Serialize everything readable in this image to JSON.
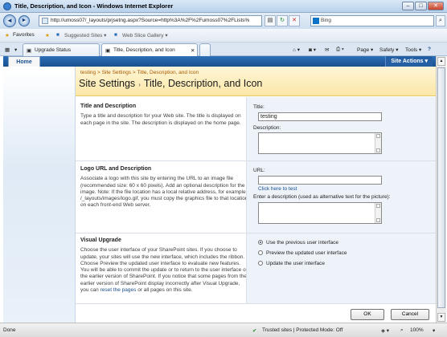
{
  "window": {
    "title": "Title, Description, and Icon - Windows Internet Explorer",
    "min": "–",
    "max": "□",
    "close": "✕"
  },
  "address": {
    "url": "http://umoss07/_layouts/prjsetng.aspx?Source=http%3A%2F%2Fumoss07%2FLists%",
    "search_placeholder": "Bing"
  },
  "favorites": {
    "label": "Favorites",
    "suggested": "Suggested Sites ▾",
    "slice": "Web Slice Gallery ▾"
  },
  "tabs": {
    "tab1": "Upgrade Status",
    "tab2": "Title, Description, and Icon"
  },
  "commandbar": {
    "page": "Page ▾",
    "safety": "Safety ▾",
    "tools": "Tools ▾",
    "help": "?"
  },
  "ribbon": {
    "home": "Home",
    "site_actions": "Site Actions ▾"
  },
  "breadcrumb": {
    "site": "testing",
    "sep1": ">",
    "settings": "Site Settings",
    "sep2": ">",
    "current": "Title, Description, and Icon"
  },
  "page_title": {
    "main": "Site Settings",
    "sep": "›",
    "sub": "Title, Description, and Icon"
  },
  "sections": {
    "title_desc": {
      "heading": "Title and Description",
      "text": "Type a title and description for your Web site. The title is displayed on each page in the site. The description is displayed on the home page.",
      "title_label": "Title:",
      "title_value": "testing",
      "desc_label": "Description:"
    },
    "logo": {
      "heading": "Logo URL and Description",
      "text": "Associate a logo with this site by entering the URL to an image file (recommended size: 60 x 60 pixels). Add an optional description for the image. Note: If the file location has a local relative address, for example, /_layouts/images/logo.gif, you must copy the graphics file to that location on each front-end Web server.",
      "url_label": "URL:",
      "test_link": "Click here to test",
      "alt_label": "Enter a description (used as alternative text for the picture):"
    },
    "upgrade": {
      "heading": "Visual Upgrade",
      "text_a": "Choose the user interface of your SharePoint sites. If you choose to update, your sites will use the new interface, which includes the ribbon. Choose Preview the updated user interface to evaluate new features. You will be able to commit the update or to return to the user interface of the earlier version of SharePoint. If you notice that some pages from the earlier version of SharePoint display incorrectly after Visual Upgrade, you can ",
      "reset_link": "reset the pages",
      "text_b": " or all pages on this site.",
      "opt1": "Use the previous user interface",
      "opt2": "Preview the updated user interface",
      "opt3": "Update the user interface",
      "selected": 1
    }
  },
  "buttons": {
    "ok": "OK",
    "cancel": "Cancel"
  },
  "status": {
    "left": "Done",
    "zone": "Trusted sites | Protected Mode: Off",
    "zoom": "100%"
  }
}
